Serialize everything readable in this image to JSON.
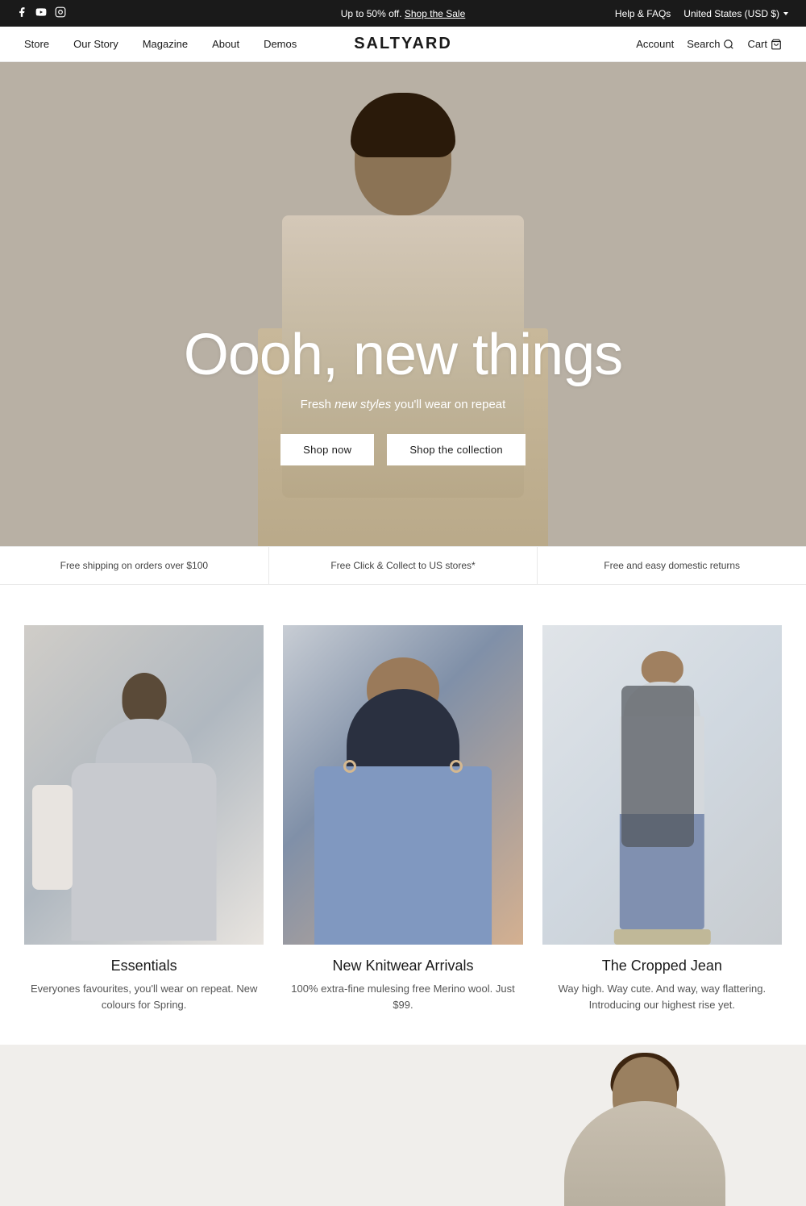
{
  "announcement": {
    "promo_text": "Up to 50% off.",
    "promo_link_text": "Shop the Sale",
    "help_link": "Help & FAQs",
    "region": "United States (USD $)"
  },
  "social_icons": [
    {
      "name": "facebook",
      "symbol": "f"
    },
    {
      "name": "youtube",
      "symbol": "▶"
    },
    {
      "name": "instagram",
      "symbol": "◎"
    }
  ],
  "nav": {
    "logo": "SALTYARD",
    "left_links": [
      {
        "label": "Store",
        "href": "#"
      },
      {
        "label": "Our Story",
        "href": "#"
      },
      {
        "label": "Magazine",
        "href": "#"
      },
      {
        "label": "About",
        "href": "#"
      },
      {
        "label": "Demos",
        "href": "#"
      }
    ],
    "right_links": [
      {
        "label": "Account",
        "href": "#"
      },
      {
        "label": "Search",
        "href": "#"
      },
      {
        "label": "Cart",
        "href": "#"
      }
    ]
  },
  "hero": {
    "title": "Oooh, new things",
    "subtitle_prefix": "Fresh ",
    "subtitle_italic": "new styles",
    "subtitle_suffix": " you'll wear on repeat",
    "btn_shop_now": "Shop now",
    "btn_shop_collection": "Shop the collection"
  },
  "benefits": [
    {
      "text": "Free shipping on orders over $100"
    },
    {
      "text": "Free Click & Collect to US stores*"
    },
    {
      "text": "Free and easy domestic returns"
    }
  ],
  "products": [
    {
      "title": "Essentials",
      "desc": "Everyones favourites, you'll wear on repeat.\nNew colours for Spring.",
      "image_class": "essentials"
    },
    {
      "title": "New Knitwear Arrivals",
      "desc": "100% extra-fine mulesing free Merino wool.\nJust $99.",
      "image_class": "knitwear"
    },
    {
      "title": "The Cropped Jean",
      "desc": "Way high. Way cute. And way, way flattering.\nIntroducing our highest rise yet.",
      "image_class": "cropped-jean"
    }
  ]
}
